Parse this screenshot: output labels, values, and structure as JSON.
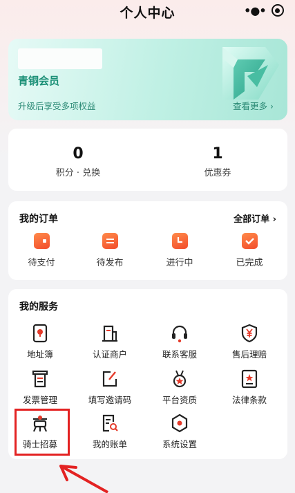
{
  "header": {
    "title": "个人中心"
  },
  "member": {
    "level": "青铜会员",
    "benefit": "升级后享受多项权益",
    "view_more": "查看更多 ›"
  },
  "stats": [
    {
      "value": "0",
      "label": "积分 · 兑换"
    },
    {
      "value": "1",
      "label": "优惠券"
    }
  ],
  "orders": {
    "title": "我的订单",
    "all_label": "全部订单 ›",
    "items": [
      {
        "label": "待支付",
        "icon": "wallet-icon"
      },
      {
        "label": "待发布",
        "icon": "list-icon"
      },
      {
        "label": "进行中",
        "icon": "clock-icon"
      },
      {
        "label": "已完成",
        "icon": "check-icon"
      }
    ]
  },
  "services": {
    "title": "我的服务",
    "items": [
      {
        "label": "地址簿",
        "icon": "address-book-icon"
      },
      {
        "label": "认证商户",
        "icon": "merchant-icon"
      },
      {
        "label": "联系客服",
        "icon": "headset-icon"
      },
      {
        "label": "售后理赔",
        "icon": "shield-yen-icon"
      },
      {
        "label": "发票管理",
        "icon": "invoice-icon"
      },
      {
        "label": "填写邀请码",
        "icon": "edit-icon"
      },
      {
        "label": "平台资质",
        "icon": "medal-icon"
      },
      {
        "label": "法律条款",
        "icon": "law-doc-icon"
      },
      {
        "label": "骑士招募",
        "icon": "rider-recruit-icon"
      },
      {
        "label": "我的账单",
        "icon": "bill-search-icon"
      },
      {
        "label": "系统设置",
        "icon": "settings-icon"
      }
    ]
  },
  "colors": {
    "accent": "#1a8f76",
    "order_icon": "#f24c2b",
    "highlight": "#e32222"
  }
}
